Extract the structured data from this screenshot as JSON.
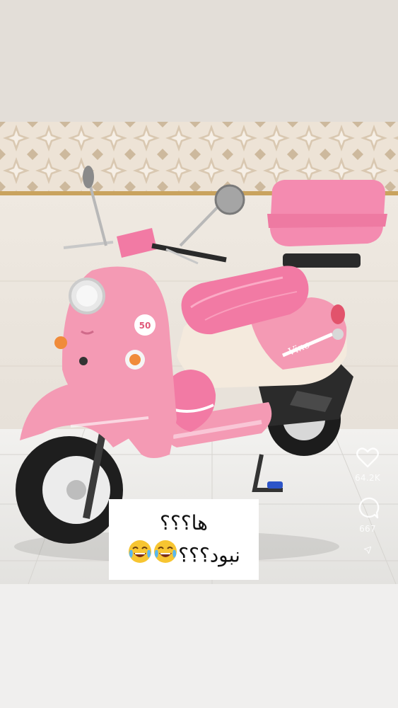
{
  "post": {
    "image_alt": "Pink Yamaha Vino scooter with top box in a showroom",
    "caption_lines": [
      "ها؟؟؟",
      "نبود؟؟؟"
    ],
    "caption_emoji_count": 2,
    "caption_emoji_icon": "face-with-tears-of-joy-icon",
    "scooter_badge": "50",
    "scooter_model_script": "Vino"
  },
  "actions": {
    "like_count": "64.2K",
    "comment_count": "667"
  },
  "colors": {
    "scooter_pink": "#f49ab4",
    "seat_pink": "#f27aa4",
    "cream": "#f4eadd",
    "tile_gold": "#c9a35e"
  }
}
